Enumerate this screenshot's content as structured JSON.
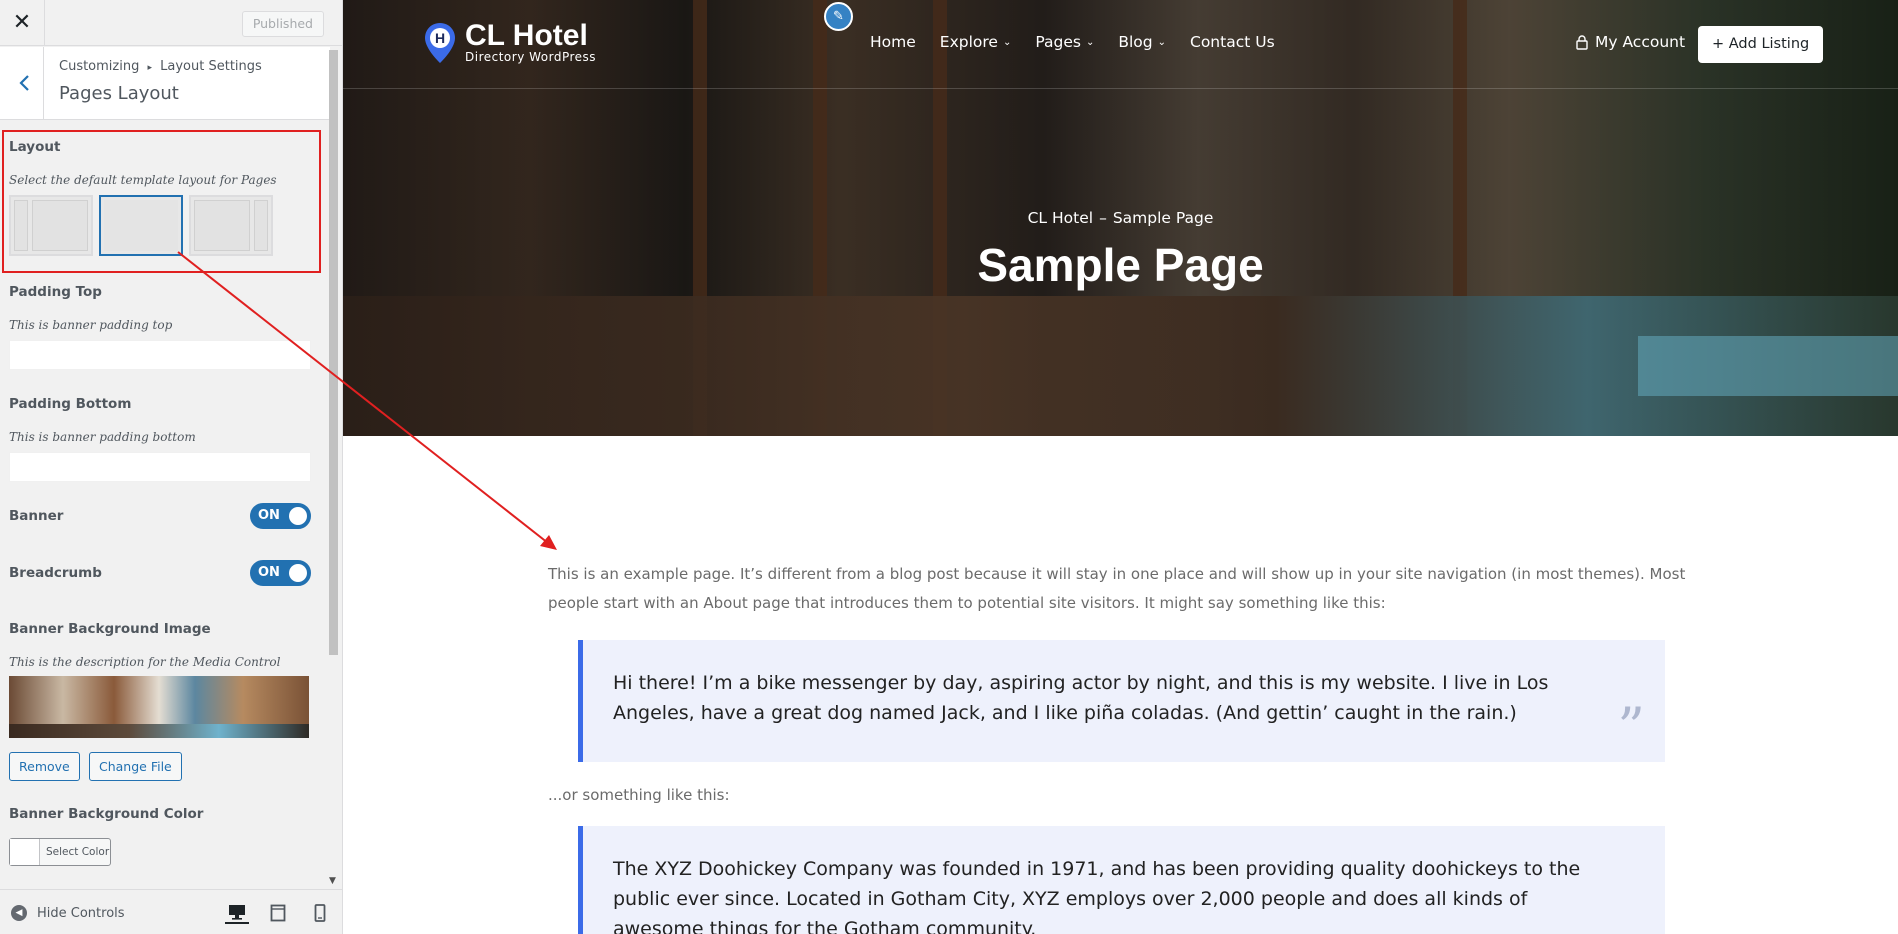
{
  "customizer": {
    "publish_label": "Published",
    "breadcrumb_root": "Customizing",
    "breadcrumb_arrow": "▸",
    "breadcrumb_section": "Layout Settings",
    "section_title": "Pages Layout",
    "layout": {
      "title": "Layout",
      "description": "Select the default template layout for Pages",
      "options": [
        "left-sidebar",
        "full-width",
        "right-sidebar"
      ],
      "selected": "full-width"
    },
    "padding_top": {
      "title": "Padding Top",
      "description": "This is banner padding top",
      "value": ""
    },
    "padding_bottom": {
      "title": "Padding Bottom",
      "description": "This is banner padding bottom",
      "value": ""
    },
    "banner": {
      "title": "Banner",
      "state": "ON"
    },
    "breadcrumb_toggle": {
      "title": "Breadcrumb",
      "state": "ON"
    },
    "banner_bg_image": {
      "title": "Banner Background Image",
      "description": "This is the description for the Media Control",
      "remove_label": "Remove",
      "change_label": "Change File"
    },
    "banner_bg_color": {
      "title": "Banner Background Color",
      "select_label": "Select Color"
    },
    "footer": {
      "hide_controls": "Hide Controls"
    },
    "accent_color": "#2271b1",
    "highlight_color": "#e02020"
  },
  "preview": {
    "logo": {
      "title": "CL Hotel",
      "subtitle": "Directory WordPress",
      "pin_letter": "H"
    },
    "nav": [
      {
        "label": "Home",
        "dropdown": false
      },
      {
        "label": "Explore",
        "dropdown": true
      },
      {
        "label": "Pages",
        "dropdown": true
      },
      {
        "label": "Blog",
        "dropdown": true
      },
      {
        "label": "Contact Us",
        "dropdown": false
      }
    ],
    "account_label": "My Account",
    "add_listing_label": "Add Listing",
    "add_listing_plus": "+",
    "breadcrumb": {
      "home": "CL Hotel",
      "sep": "–",
      "current": "Sample Page"
    },
    "page_title": "Sample Page",
    "body": {
      "intro": "This is an example page. It’s different from a blog post because it will stay in one place and will show up in your site navigation (in most themes). Most people start with an About page that introduces them to potential site visitors. It might say something like this:",
      "quote1": "Hi there! I’m a bike messenger by day, aspiring actor by night, and this is my website. I live in Los Angeles, have a great dog named Jack, and I like piña coladas. (And gettin’ caught in the rain.)",
      "quote_mark": "”",
      "between": "...or something like this:",
      "quote2": "The XYZ Doohickey Company was founded in 1971, and has been providing quality doohickeys to the public ever since. Located in Gotham City, XYZ employs over 2,000 people and does all kinds of awesome things for the Gotham community."
    },
    "quote_border_color": "#3b6be8",
    "quote_bg_color": "#eef1fc"
  }
}
